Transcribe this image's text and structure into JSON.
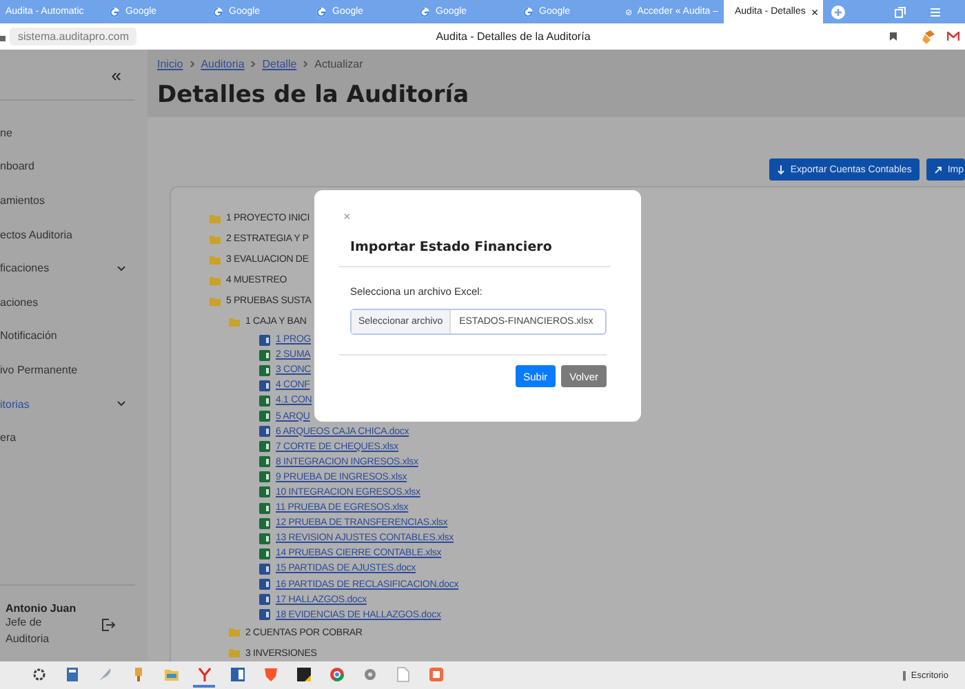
{
  "browser": {
    "tabs": [
      {
        "label": "Audita - Automatic",
        "kind": "blank",
        "selected": false
      },
      {
        "label": "Google",
        "kind": "google",
        "selected": false
      },
      {
        "label": "Google",
        "kind": "google",
        "selected": false
      },
      {
        "label": "Google",
        "kind": "google",
        "selected": false
      },
      {
        "label": "Google",
        "kind": "google",
        "selected": false
      },
      {
        "label": "Google",
        "kind": "google",
        "selected": false
      },
      {
        "label": "Acceder « Audita –",
        "kind": "check",
        "selected": false
      },
      {
        "label": "Audita - Detalles",
        "kind": "page",
        "selected": true,
        "close": "×"
      }
    ],
    "url": "sistema.auditapro.com",
    "page_title": "Audita - Detalles de la Auditoría"
  },
  "sidebar": {
    "collapse": "«",
    "items": [
      {
        "label": "ne",
        "selected": false,
        "expandable": false
      },
      {
        "label": "nboard",
        "selected": false,
        "expandable": false
      },
      {
        "label": "amientos",
        "selected": false,
        "expandable": false
      },
      {
        "label": "ectos Auditoria",
        "selected": false,
        "expandable": false
      },
      {
        "label": "ficaciones",
        "selected": false,
        "expandable": true
      },
      {
        "label": "aciones",
        "selected": false,
        "expandable": false
      },
      {
        "label": "Notificación",
        "selected": false,
        "expandable": false
      },
      {
        "label": "ivo Permanente",
        "selected": false,
        "expandable": false
      },
      {
        "label": "itorias",
        "selected": true,
        "expandable": true
      },
      {
        "label": "era",
        "selected": false,
        "expandable": false
      }
    ],
    "user": {
      "name": "Antonio Juan",
      "role": "Jefe de Auditoria"
    }
  },
  "breadcrumb": [
    {
      "label": "Inicio",
      "link": true
    },
    {
      "label": "Auditoria",
      "link": true
    },
    {
      "label": "Detalle",
      "link": true
    },
    {
      "label": "Actualizar",
      "link": false
    }
  ],
  "title": "Detalles de la Auditoría",
  "actions": [
    {
      "label": "Exportar Cuentas Contables",
      "kind": "export"
    },
    {
      "label": "Imp",
      "kind": "import"
    }
  ],
  "tree": [
    {
      "label": "1 PROYECTO INICI",
      "kind": "folder"
    },
    {
      "label": "2 ESTRATEGIA Y P",
      "kind": "folder"
    },
    {
      "label": "3 EVALUACION DE",
      "kind": "folder"
    },
    {
      "label": "4 MUESTREO",
      "kind": "folder"
    },
    {
      "label": "5 PRUEBAS SUSTA",
      "kind": "folder",
      "children": [
        {
          "label": "1 CAJA Y BAN",
          "kind": "folder",
          "children": [
            {
              "label": "1 PROG",
              "kind": "word"
            },
            {
              "label": "2 SUMA",
              "kind": "excel"
            },
            {
              "label": "3 CONC",
              "kind": "excel"
            },
            {
              "label": "4 CONF",
              "kind": "word"
            },
            {
              "label": "4.1 CON",
              "kind": "excel"
            },
            {
              "label": "5 ARQU",
              "kind": "excel"
            },
            {
              "label": "6 ARQUEOS CAJA CHICA.docx",
              "kind": "word"
            },
            {
              "label": "7 CORTE DE CHEQUES.xlsx",
              "kind": "excel"
            },
            {
              "label": "8 INTEGRACION INGRESOS.xlsx",
              "kind": "excel"
            },
            {
              "label": "9 PRUEBA DE INGRESOS.xlsx",
              "kind": "excel"
            },
            {
              "label": "10 INTEGRACION EGRESOS.xlsx",
              "kind": "excel"
            },
            {
              "label": "11 PRUEBA DE EGRESOS.xlsx",
              "kind": "excel"
            },
            {
              "label": "12 PRUEBA DE TRANSFERENCIAS.xlsx",
              "kind": "excel"
            },
            {
              "label": "13 REVISION AJUSTES CONTABLES.xlsx",
              "kind": "excel"
            },
            {
              "label": "14 PRUEBAS CIERRE CONTABLE.xlsx",
              "kind": "excel"
            },
            {
              "label": "15 PARTIDAS DE AJUSTES.docx",
              "kind": "word"
            },
            {
              "label": "16 PARTIDAS DE RECLASIFICACION.docx",
              "kind": "word"
            },
            {
              "label": "17 HALLAZGOS.docx",
              "kind": "word"
            },
            {
              "label": "18 EVIDENCIAS DE HALLAZGOS.docx",
              "kind": "word"
            }
          ]
        },
        {
          "label": "2 CUENTAS POR COBRAR",
          "kind": "folder"
        },
        {
          "label": "3 INVERSIONES",
          "kind": "folder"
        }
      ]
    }
  ],
  "modal": {
    "close": "×",
    "title": "Importar Estado Financiero",
    "label": "Selecciona un archivo Excel:",
    "file_button": "Seleccionar archivo",
    "file_name": "ESTADOS-FINANCIEROS.xlsx",
    "buttons": [
      {
        "label": "Subir",
        "kind": "primary"
      },
      {
        "label": "Volver",
        "kind": "secondary"
      }
    ]
  },
  "taskbar": {
    "apps": [
      {
        "kind": "gear",
        "selected": false
      },
      {
        "kind": "calculator",
        "selected": false
      },
      {
        "kind": "quill",
        "selected": false
      },
      {
        "kind": "brush",
        "selected": false
      },
      {
        "kind": "folder",
        "selected": false
      },
      {
        "kind": "red",
        "selected": true
      },
      {
        "kind": "document",
        "selected": false
      },
      {
        "kind": "shield",
        "selected": false
      },
      {
        "kind": "note",
        "selected": false
      },
      {
        "kind": "globe",
        "selected": false
      },
      {
        "kind": "disc",
        "selected": false
      },
      {
        "kind": "page",
        "selected": false
      },
      {
        "kind": "square",
        "selected": false
      }
    ],
    "desktop": "Escritorio"
  }
}
